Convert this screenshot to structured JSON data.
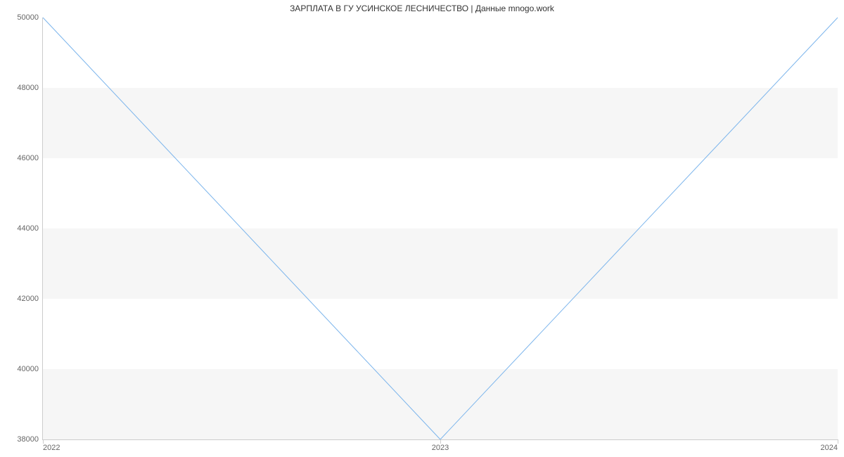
{
  "chart_data": {
    "type": "line",
    "title": "ЗАРПЛАТА В ГУ УСИНСКОЕ ЛЕСНИЧЕСТВО | Данные mnogo.work",
    "xlabel": "",
    "ylabel": "",
    "x_categories": [
      "2022",
      "2023",
      "2024"
    ],
    "y_ticks": [
      38000,
      40000,
      42000,
      44000,
      46000,
      48000,
      50000
    ],
    "ylim": [
      38000,
      50000
    ],
    "series": [
      {
        "name": "salary",
        "color": "#7cb5ec",
        "values": [
          50000,
          38000,
          50000
        ]
      }
    ],
    "bands": true
  }
}
